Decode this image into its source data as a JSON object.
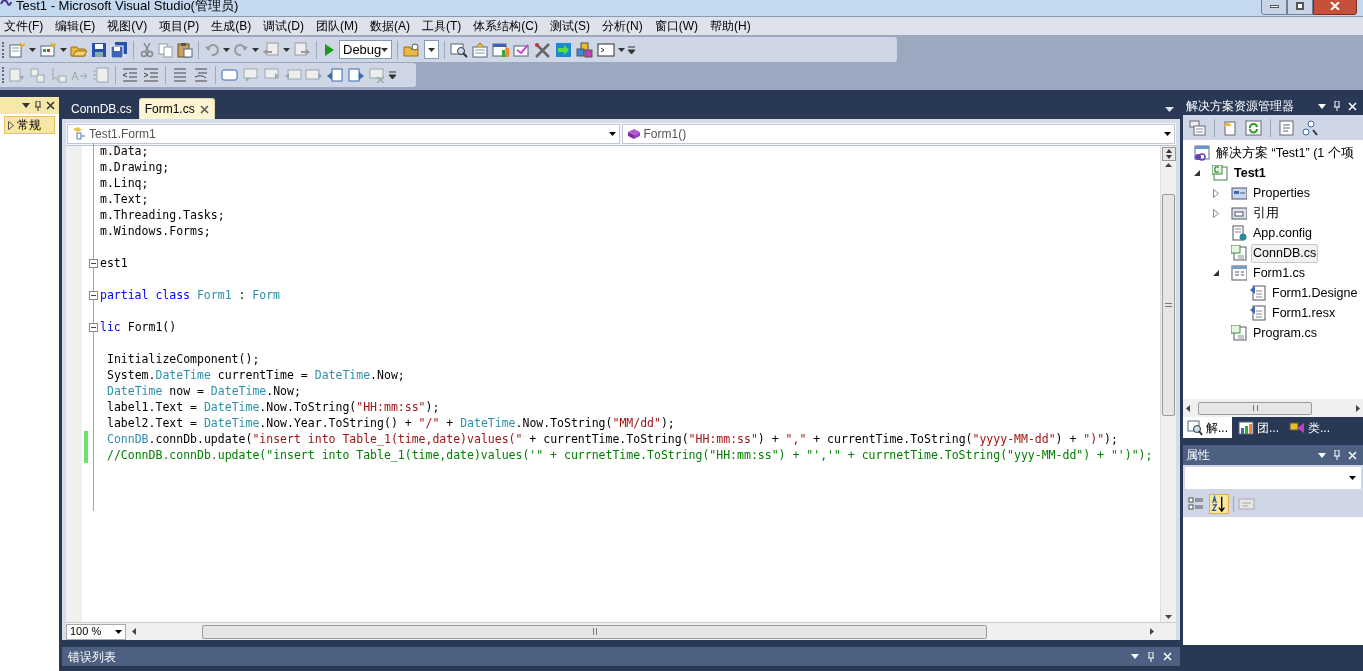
{
  "window": {
    "title": "Test1 - Microsoft Visual Studio(管理员)"
  },
  "menu": [
    "文件(F)",
    "编辑(E)",
    "视图(V)",
    "项目(P)",
    "生成(B)",
    "调试(D)",
    "团队(M)",
    "数据(A)",
    "工具(T)",
    "体系结构(C)",
    "测试(S)",
    "分析(N)",
    "窗口(W)",
    "帮助(H)"
  ],
  "toolbar": {
    "configuration": "Debug"
  },
  "toolbox": {
    "items": [
      {
        "label": "常规",
        "expanded": false
      }
    ]
  },
  "editor": {
    "tabs": [
      {
        "label": "ConnDB.cs",
        "selected": false
      },
      {
        "label": "Form1.cs",
        "selected": true
      }
    ],
    "type_dropdown": "Test1.Form1",
    "member_dropdown": "Form1()",
    "zoom": "100 %",
    "lines": [
      {
        "tokens": [
          {
            "kind": "plain",
            "text": "m.Data;"
          }
        ]
      },
      {
        "tokens": [
          {
            "kind": "plain",
            "text": "m.Drawing;"
          }
        ]
      },
      {
        "tokens": [
          {
            "kind": "plain",
            "text": "m.Linq;"
          }
        ]
      },
      {
        "tokens": [
          {
            "kind": "plain",
            "text": "m.Text;"
          }
        ]
      },
      {
        "tokens": [
          {
            "kind": "plain",
            "text": "m.Threading.Tasks;"
          }
        ]
      },
      {
        "tokens": [
          {
            "kind": "plain",
            "text": "m.Windows.Forms;"
          }
        ]
      },
      {
        "blank_before": true,
        "fold": true,
        "tokens": [
          {
            "kind": "plain",
            "text": "est1"
          }
        ]
      },
      {
        "blank_before": true,
        "fold": true,
        "tokens": [
          {
            "kind": "keyword",
            "text": "partial class "
          },
          {
            "kind": "type",
            "text": "Form1"
          },
          {
            "kind": "plain",
            "text": " : "
          },
          {
            "kind": "type",
            "text": "Form"
          }
        ]
      },
      {
        "blank_before": true,
        "fold": true,
        "tokens": [
          {
            "kind": "keyword",
            "text": "lic"
          },
          {
            "kind": "plain",
            "text": " Form1()"
          }
        ]
      },
      {
        "blank_before": true,
        "indented": true,
        "tokens": [
          {
            "kind": "plain",
            "text": "InitializeComponent();"
          }
        ]
      },
      {
        "indented": true,
        "tokens": [
          {
            "kind": "plain",
            "text": "System."
          },
          {
            "kind": "type",
            "text": "DateTime"
          },
          {
            "kind": "plain",
            "text": " currentTime = "
          },
          {
            "kind": "type",
            "text": "DateTime"
          },
          {
            "kind": "plain",
            "text": ".Now;"
          }
        ]
      },
      {
        "indented": true,
        "tokens": [
          {
            "kind": "type",
            "text": "DateTime"
          },
          {
            "kind": "plain",
            "text": " now = "
          },
          {
            "kind": "type",
            "text": "DateTime"
          },
          {
            "kind": "plain",
            "text": ".Now;"
          }
        ]
      },
      {
        "indented": true,
        "tokens": [
          {
            "kind": "plain",
            "text": "label1.Text = "
          },
          {
            "kind": "type",
            "text": "DateTime"
          },
          {
            "kind": "plain",
            "text": ".Now.ToString("
          },
          {
            "kind": "string",
            "text": "\"HH:mm:ss\""
          },
          {
            "kind": "plain",
            "text": ");"
          }
        ]
      },
      {
        "indented": true,
        "tokens": [
          {
            "kind": "plain",
            "text": "label2.Text = "
          },
          {
            "kind": "type",
            "text": "DateTime"
          },
          {
            "kind": "plain",
            "text": ".Now.Year.ToString() + "
          },
          {
            "kind": "string",
            "text": "\"/\""
          },
          {
            "kind": "plain",
            "text": " + "
          },
          {
            "kind": "type",
            "text": "DateTime"
          },
          {
            "kind": "plain",
            "text": ".Now.ToString("
          },
          {
            "kind": "string",
            "text": "\"MM/dd\""
          },
          {
            "kind": "plain",
            "text": ");"
          }
        ]
      },
      {
        "indented": true,
        "changed": true,
        "tokens": [
          {
            "kind": "type",
            "text": "ConnDB"
          },
          {
            "kind": "plain",
            "text": ".connDb.update("
          },
          {
            "kind": "string",
            "text": "\"insert into Table_1(time,date)values(\""
          },
          {
            "kind": "plain",
            "text": " + currentTime.ToString("
          },
          {
            "kind": "string",
            "text": "\"HH:mm:ss\""
          },
          {
            "kind": "plain",
            "text": ") + "
          },
          {
            "kind": "string",
            "text": "\",\""
          },
          {
            "kind": "plain",
            "text": " + currentTime.ToString("
          },
          {
            "kind": "string",
            "text": "\"yyyy-MM-dd\""
          },
          {
            "kind": "plain",
            "text": ") + "
          },
          {
            "kind": "string",
            "text": "\")\""
          },
          {
            "kind": "plain",
            "text": ");"
          }
        ]
      },
      {
        "indented": true,
        "changed": true,
        "tokens": [
          {
            "kind": "comment",
            "text": "//ConnDB.connDb.update(\"insert into Table_1(time,date)values('\" + currnetTime.ToString(\"HH:mm:ss\") + \"','\" + currnetTime.ToString(\"yyy-MM-dd\") + \"')\");"
          }
        ]
      }
    ]
  },
  "solution_explorer": {
    "title": "解决方案资源管理器",
    "tree": [
      {
        "label": "解决方案 “Test1” (1 个项",
        "kind": "solution",
        "selected": false,
        "children": [
          {
            "label": "Test1",
            "kind": "project",
            "expanded": true,
            "selected": false,
            "children": [
              {
                "label": "Properties",
                "kind": "properties",
                "expanded": false,
                "selected": false
              },
              {
                "label": "引用",
                "kind": "references",
                "expanded": false,
                "selected": false
              },
              {
                "label": "App.config",
                "kind": "config",
                "selected": false
              },
              {
                "label": "ConnDB.cs",
                "kind": "code",
                "selected": true
              },
              {
                "label": "Form1.cs",
                "kind": "form",
                "expanded": true,
                "selected": false,
                "children": [
                  {
                    "label": "Form1.Designe",
                    "kind": "designer",
                    "selected": false
                  },
                  {
                    "label": "Form1.resx",
                    "kind": "designer",
                    "selected": false
                  }
                ]
              },
              {
                "label": "Program.cs",
                "kind": "code",
                "selected": false
              }
            ]
          }
        ]
      }
    ],
    "tabs": [
      {
        "label": "解...",
        "selected": true
      },
      {
        "label": "团...",
        "selected": false
      },
      {
        "label": "类...",
        "selected": false
      }
    ]
  },
  "properties": {
    "title": "属性"
  },
  "error_list": {
    "title": "错误列表"
  }
}
